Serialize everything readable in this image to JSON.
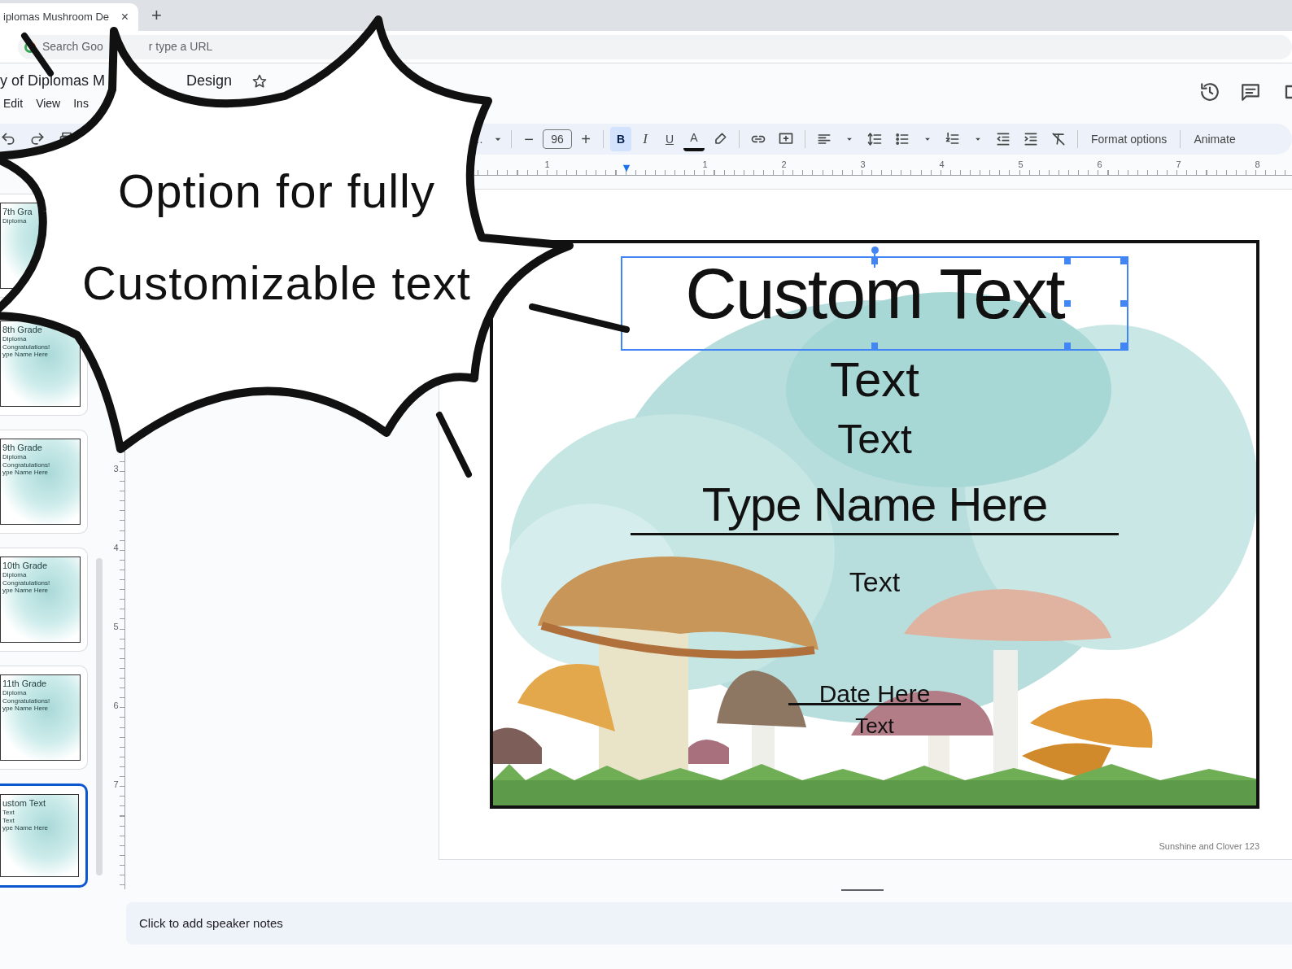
{
  "browser": {
    "tab": {
      "title": "iplomas Mushroom De",
      "close": "×"
    },
    "new_tab": "+",
    "address_bar": {
      "visible_text": [
        "Search Goo",
        "r type a URL"
      ]
    }
  },
  "document": {
    "title_parts": [
      "y of Diplomas M",
      "Design"
    ]
  },
  "menu": [
    "Edit",
    "View",
    "Ins"
  ],
  "toolbar": {
    "font_name": "…",
    "minus": "−",
    "font_size": "96",
    "plus": "+",
    "format_buttons": [
      {
        "label": "B",
        "selected": true
      },
      {
        "label": "I",
        "selected": false
      },
      {
        "label": "U",
        "selected": false
      },
      {
        "label": "A",
        "selected": false
      }
    ],
    "format_options": "Format options",
    "animate": "Animate"
  },
  "horizontal_ruler": [
    "1",
    "1",
    "2",
    "3",
    "4",
    "5",
    "6",
    "7",
    "8"
  ],
  "vertical_ruler": [
    "3",
    "4",
    "5",
    "6",
    "7"
  ],
  "filmstrip": [
    {
      "lines": [
        "7th Gra",
        "Diploma"
      ],
      "selected": false
    },
    {
      "lines": [
        "8th Grade",
        "Diploma",
        "Congratulations!",
        "ype Name Here"
      ],
      "selected": false
    },
    {
      "lines": [
        "9th Grade",
        "Diploma",
        "Congratulations!",
        "ype Name Here"
      ],
      "selected": false
    },
    {
      "lines": [
        "10th Grade",
        "Diploma",
        "Congratulations!",
        "ype Name Here"
      ],
      "selected": false
    },
    {
      "lines": [
        "11th Grade",
        "Diploma",
        "Congratulations!",
        "ype Name Here"
      ],
      "selected": false
    },
    {
      "lines": [
        "ustom Text",
        "Text",
        "Text",
        "ype Name Here"
      ],
      "selected": true
    }
  ],
  "slide": {
    "texts": [
      {
        "kind": "title",
        "text": "Custom Text",
        "selected": true
      },
      {
        "kind": "large",
        "text": "Text",
        "selected": false
      },
      {
        "kind": "medium",
        "text": "Text",
        "selected": false
      },
      {
        "kind": "name",
        "text": "Type Name Here",
        "selected": false
      },
      {
        "kind": "small",
        "text": "Text",
        "selected": false
      },
      {
        "kind": "date",
        "text": "Date Here",
        "selected": false
      },
      {
        "kind": "tiny",
        "text": "Text",
        "selected": false
      }
    ],
    "footer": "Sunshine and Clover 123"
  },
  "speaker_notes": {
    "hint": "Click to add speaker notes"
  },
  "callout": {
    "lines": [
      "Option for fully",
      "Customizable text"
    ]
  }
}
